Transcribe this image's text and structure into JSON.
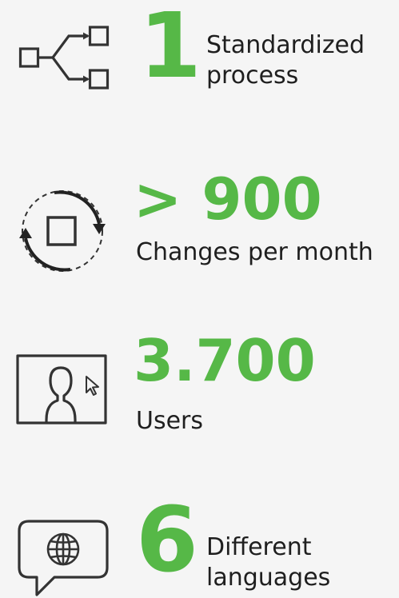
{
  "accent_color": "#56b847",
  "stats": [
    {
      "icon": "process-flow-icon",
      "value": "1",
      "label_lines": [
        "Standardized",
        "process"
      ]
    },
    {
      "icon": "change-cycle-icon",
      "value": "> 900",
      "label_lines": [
        "Changes per month"
      ]
    },
    {
      "icon": "user-screen-icon",
      "value": "3.700",
      "label_lines": [
        "Users"
      ]
    },
    {
      "icon": "globe-chat-icon",
      "value": "6",
      "label_lines": [
        "Different",
        "languages"
      ]
    }
  ]
}
